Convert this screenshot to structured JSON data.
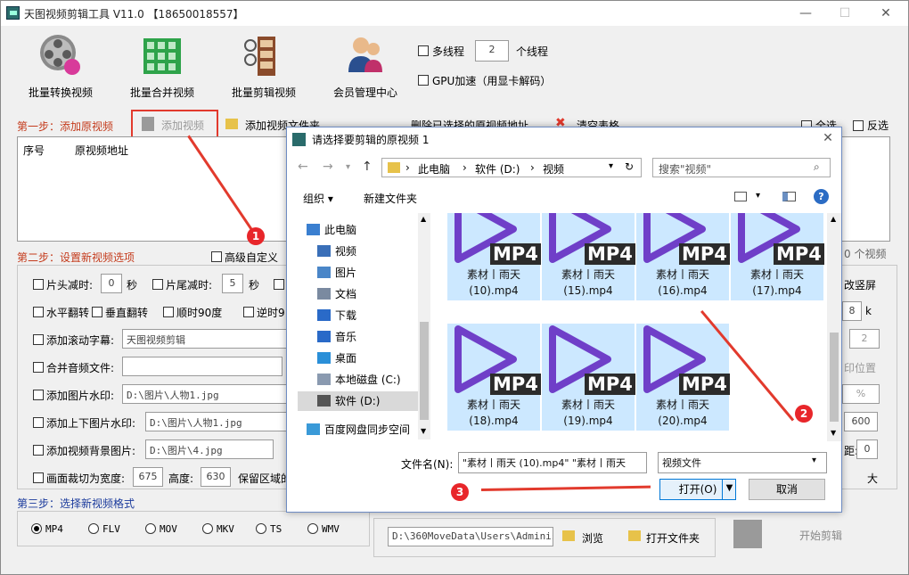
{
  "window": {
    "title": "天图视频剪辑工具 V11.0 【18650018557】",
    "min": "—",
    "max": "☐",
    "close": "✕"
  },
  "toolbar": {
    "batch_convert": "批量转换视频",
    "batch_merge": "批量合并视频",
    "batch_edit": "批量剪辑视频",
    "member": "会员管理中心",
    "multithread": "多线程",
    "thread_count": "2",
    "thread_unit": "个线程",
    "gpu": "GPU加速（用显卡解码）"
  },
  "step1": {
    "label": "第一步：添加原视频",
    "add_video": "添加视频",
    "add_folder": "添加视频文件夹",
    "delete_selected": "删除已选择的原视频地址",
    "clear_table": "清空表格",
    "select_all": "全选",
    "invert": "反选",
    "col_index": "序号",
    "col_path": "原视频地址",
    "count": "0 个视频"
  },
  "step2": {
    "label": "第二步：设置新视频选项",
    "advanced": "高级自定义",
    "head_cut": "片头减时:",
    "head_val": "0",
    "sec1": "秒",
    "tail_cut": "片尾减时:",
    "tail_val": "5",
    "sec2": "秒",
    "hflip": "水平翻转",
    "vflip": "垂直翻转",
    "rot90": "顺时90度",
    "rot_ccw": "逆时9",
    "scroll_sub": "添加滚动字幕:",
    "scroll_val": "天图视频剪辑",
    "merge_audio": "合并音频文件:",
    "img_watermark": "添加图片水印:",
    "img_wm_val": "D:\\图片\\人物1.jpg",
    "updown_watermark": "添加上下图片水印:",
    "updown_val": "D:\\图片\\人物1.jpg",
    "bg_image": "添加视频背景图片:",
    "bg_val": "D:\\图片\\4.jpg",
    "crop": "画面裁切为宽度:",
    "crop_w": "675",
    "crop_h_label": "高度:",
    "crop_h": "630",
    "keep_region": "保留区域的",
    "right_portrait": "改竖屏",
    "right_k_val": "8",
    "right_k": "k",
    "right_sel": "2",
    "right_wm_pos": "印位置",
    "right_pct": "%",
    "right_600": "600",
    "right_0_label": "距:",
    "right_0": "0",
    "right_big": "大"
  },
  "step3": {
    "label": "第三步：选择新视频格式",
    "formats": [
      "MP4",
      "FLV",
      "MOV",
      "MKV",
      "TS",
      "WMV"
    ],
    "out_path": "D:\\360MoveData\\Users\\Administr",
    "browse": "浏览",
    "open_folder": "打开文件夹",
    "start": "开始剪辑"
  },
  "dialog": {
    "title": "请选择要剪辑的原视频 1",
    "close": "✕",
    "path": [
      "此电脑",
      "软件 (D:)",
      "视频"
    ],
    "search_placeholder": "搜索\"视频\"",
    "organize": "组织 ▾",
    "new_folder": "新建文件夹",
    "tree": [
      "此电脑",
      "视频",
      "图片",
      "文档",
      "下载",
      "音乐",
      "桌面",
      "本地磁盘 (C:)",
      "软件 (D:)",
      "百度网盘同步空间"
    ],
    "files": [
      {
        "line1": "素材丨雨天",
        "line2": "(10).mp4"
      },
      {
        "line1": "素材丨雨天",
        "line2": "(15).mp4"
      },
      {
        "line1": "素材丨雨天",
        "line2": "(16).mp4"
      },
      {
        "line1": "素材丨雨天",
        "line2": "(17).mp4"
      },
      {
        "line1": "素材丨雨天",
        "line2": "(18).mp4"
      },
      {
        "line1": "素材丨雨天",
        "line2": "(19).mp4"
      },
      {
        "line1": "素材丨雨天",
        "line2": "(20).mp4"
      }
    ],
    "file_badge": "MP4",
    "filename_label": "文件名(N):",
    "filename_value": "\"素材丨雨天 (10).mp4\" \"素材丨雨天",
    "filetype": "视频文件",
    "open": "打开(O)",
    "cancel": "取消"
  },
  "annotations": [
    "1",
    "2",
    "3"
  ]
}
